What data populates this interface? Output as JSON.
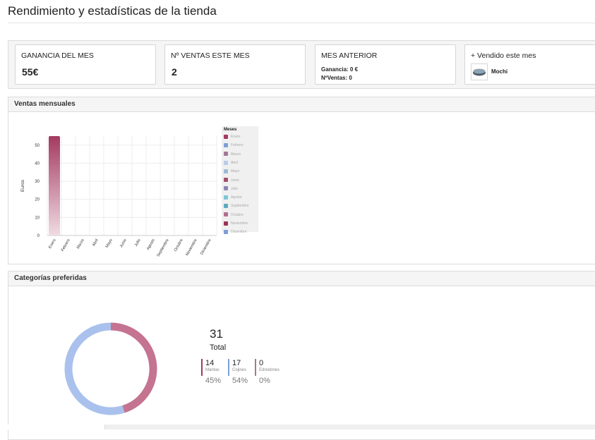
{
  "page": {
    "title": "Rendimiento y estadísticas de la tienda"
  },
  "kpis": {
    "ganancia": {
      "label": "GANANCIA DEL MES",
      "value": "55€"
    },
    "ventas": {
      "label": "Nº VENTAS ESTE MES",
      "value": "2"
    },
    "anterior": {
      "label": "MES ANTERIOR",
      "ganancia": "Ganancia: 0 €",
      "ventas": "NºVentas: 0"
    },
    "vendido": {
      "label": "+ Vendido este mes",
      "product": "Mochi"
    }
  },
  "monthly": {
    "panel_title": "Ventas mensuales",
    "legend_title": "Meses",
    "months": [
      "Enero",
      "Febrero",
      "Marzo",
      "Abril",
      "Mayo",
      "Junio",
      "Julio",
      "Agosto",
      "Septiembre",
      "Octubre",
      "Noviembre",
      "Diciembre"
    ],
    "colors": [
      "#a33a60",
      "#7e9fd4",
      "#a27895",
      "#b8cde9",
      "#9fbad8",
      "#a3506a",
      "#8b87b0",
      "#7fc6d8",
      "#5fa8bf",
      "#b36f8d",
      "#9b3354",
      "#7c9ed9"
    ]
  },
  "categories": {
    "panel_title": "Categorías preferidas",
    "total": "31",
    "total_label": "Total",
    "items": [
      {
        "count": "14",
        "name": "Mantas",
        "pct": "45%",
        "color": "#c47390"
      },
      {
        "count": "17",
        "name": "Cojines",
        "pct": "54%",
        "color": "#a9c1ec"
      },
      {
        "count": "0",
        "name": "Edredones",
        "pct": "0%",
        "color": "#a33a60"
      }
    ]
  },
  "chart_data": [
    {
      "type": "bar",
      "categories": [
        "Enero",
        "Febrero",
        "Marzo",
        "Abril",
        "Mayo",
        "Junio",
        "Julio",
        "Agosto",
        "Septiembre",
        "Octubre",
        "Noviembre",
        "Diciembre"
      ],
      "values": [
        55,
        0,
        0,
        0,
        0,
        0,
        0,
        0,
        0,
        0,
        0,
        0
      ],
      "xlabel": "Ventas mensuales",
      "ylabel": "Euros",
      "ylim": [
        0,
        55
      ],
      "yticks": [
        0,
        10,
        20,
        30,
        40,
        50
      ],
      "legend": {
        "title": "Meses",
        "placement": "right"
      },
      "grid": true
    },
    {
      "type": "pie",
      "labels": [
        "Mantas",
        "Cojines",
        "Edredones"
      ],
      "values": [
        14,
        17,
        0
      ],
      "donut": true
    }
  ]
}
